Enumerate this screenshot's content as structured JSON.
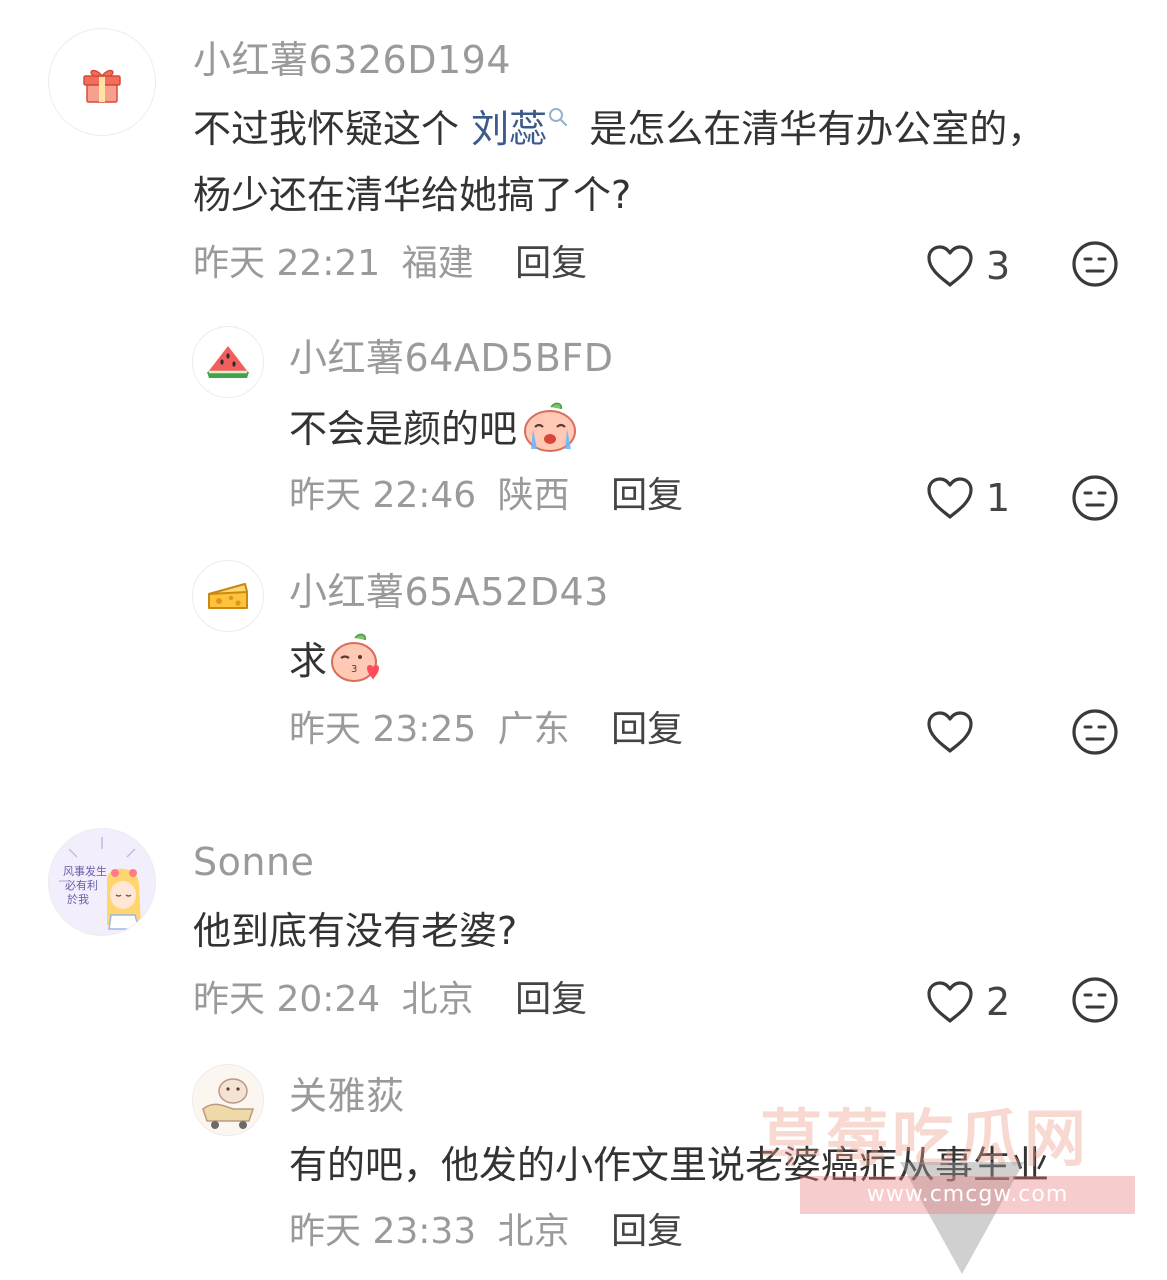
{
  "comments": [
    {
      "username": "小红薯6326D194",
      "text_parts": [
        "不过我怀疑这个 ",
        "刘蕊",
        " 是怎么在清华有办公室的，"
      ],
      "text_line2": "杨少还在清华给她搞了个?",
      "time": "昨天 22:21",
      "location": "福建",
      "reply_label": "回复",
      "likes": "3",
      "avatar_icon": "gift-icon"
    },
    {
      "username": "小红薯64AD5BFD",
      "text": "不会是颜的吧",
      "emoji": "crying-peach-emoji",
      "time": "昨天 22:46",
      "location": "陕西",
      "reply_label": "回复",
      "likes": "1",
      "avatar_icon": "watermelon-icon"
    },
    {
      "username": "小红薯65A52D43",
      "text": "求",
      "emoji": "kiss-peach-emoji",
      "time": "昨天 23:25",
      "location": "广东",
      "reply_label": "回复",
      "likes": "",
      "avatar_icon": "cheese-icon"
    },
    {
      "username": "Sonne",
      "text": "他到底有没有老婆?",
      "time": "昨天 20:24",
      "location": "北京",
      "reply_label": "回复",
      "likes": "2",
      "avatar_icon": "anime-girl-avatar"
    },
    {
      "username": "关雅荻",
      "text": "有的吧，他发的小作文里说老婆癌症从事生业",
      "time": "昨天 23:33",
      "location": "北京",
      "reply_label": "回复",
      "avatar_icon": "cartoon-avatar"
    }
  ],
  "watermark": {
    "title": "草莓吃瓜网",
    "url": "www.cmcgw.com"
  }
}
